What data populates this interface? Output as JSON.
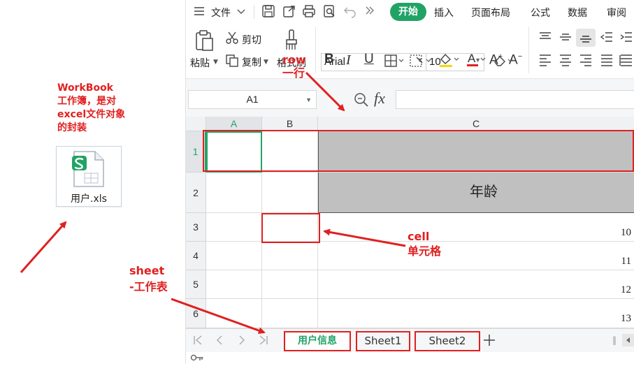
{
  "annotations": {
    "workbook_note": [
      "WorkBook",
      "工作簿，是对",
      "excel文件对象",
      "的封装"
    ],
    "row_note": [
      "row",
      "一行"
    ],
    "cell_note": [
      "cell",
      "单元格"
    ],
    "sheet_note": [
      "sheet",
      "-工作表"
    ]
  },
  "file": {
    "name": "用户.xls"
  },
  "menu": {
    "file_label": "文件",
    "tabs": [
      "开始",
      "插入",
      "页面布局",
      "公式",
      "数据",
      "审阅"
    ],
    "active_tab": "开始"
  },
  "ribbon": {
    "paste": "粘贴",
    "cut": "剪切",
    "copy": "复制",
    "format_painter": "格式刷",
    "font_name": "Arial",
    "font_size": "10"
  },
  "formula_bar": {
    "name_box": "A1",
    "fx": "fx",
    "formula": ""
  },
  "grid": {
    "columns": [
      "A",
      "B",
      "C"
    ],
    "rows": [
      "1",
      "2",
      "3",
      "4",
      "5",
      "6"
    ],
    "header_text": "年龄",
    "values": [
      "10",
      "11",
      "12",
      "13"
    ]
  },
  "sheets": [
    "用户信息",
    "Sheet1",
    "Sheet2"
  ],
  "active_sheet": "用户信息",
  "colors": {
    "accent": "#21a366",
    "annotation": "#e02020",
    "header_fill": "#c0c0c0"
  }
}
